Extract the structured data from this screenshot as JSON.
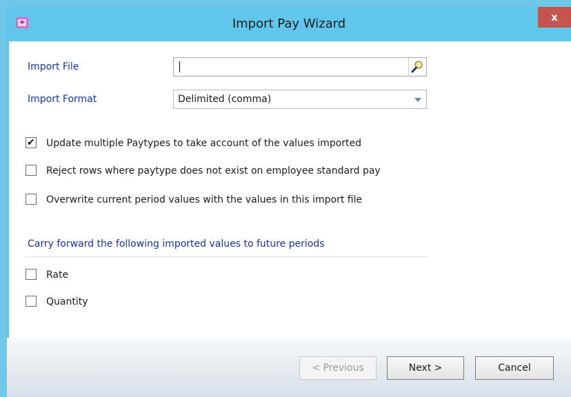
{
  "window": {
    "title": "Import Pay Wizard",
    "close_label": "x"
  },
  "form": {
    "import_file": {
      "label": "Import File",
      "value": ""
    },
    "import_format": {
      "label": "Import Format",
      "value": "Delimited (comma)"
    }
  },
  "options": [
    {
      "label": "Update multiple Paytypes to take account of the values imported",
      "checked": true
    },
    {
      "label": "Reject rows where paytype does not exist on employee standard pay",
      "checked": false
    },
    {
      "label": "Overwrite current period values with the values in this import file",
      "checked": false
    }
  ],
  "carry_forward": {
    "heading": "Carry forward the following imported values to future periods",
    "items": [
      {
        "label": "Rate",
        "checked": false
      },
      {
        "label": "Quantity",
        "checked": false
      }
    ]
  },
  "buttons": {
    "previous": "< Previous",
    "next": "Next >",
    "cancel": "Cancel"
  },
  "icons": {
    "app": "wizard-app-icon",
    "search": "magnifier-icon",
    "dropdown": "chevron-down-icon"
  }
}
